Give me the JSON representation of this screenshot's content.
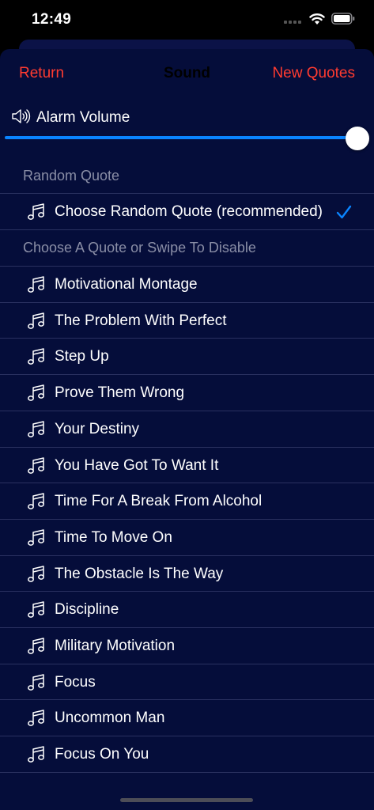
{
  "status": {
    "time": "12:49"
  },
  "nav": {
    "return_label": "Return",
    "title": "Sound",
    "new_quotes_label": "New Quotes"
  },
  "volume": {
    "label": "Alarm Volume",
    "level": 1.0
  },
  "random_section": {
    "header": "Random Quote",
    "item_label": "Choose Random Quote (recommended)",
    "selected": true
  },
  "quotes_section": {
    "header": "Choose A Quote or Swipe To Disable",
    "items": [
      "Motivational Montage",
      "The Problem With Perfect",
      "Step Up",
      "Prove Them Wrong",
      "Your Destiny",
      "You Have Got To Want It",
      "Time For A Break From Alcohol",
      "Time To Move On",
      "The Obstacle Is The Way",
      "Discipline",
      "Military Motivation",
      "Focus",
      "Uncommon Man",
      "Focus On You"
    ]
  },
  "colors": {
    "accent_red": "#ff3b30",
    "accent_blue": "#0a84ff",
    "sheet_bg": "#050d3a"
  },
  "icons": {
    "row_icon": "music-note-icon",
    "volume_icon": "speaker-icon",
    "check_icon": "checkmark-icon"
  }
}
